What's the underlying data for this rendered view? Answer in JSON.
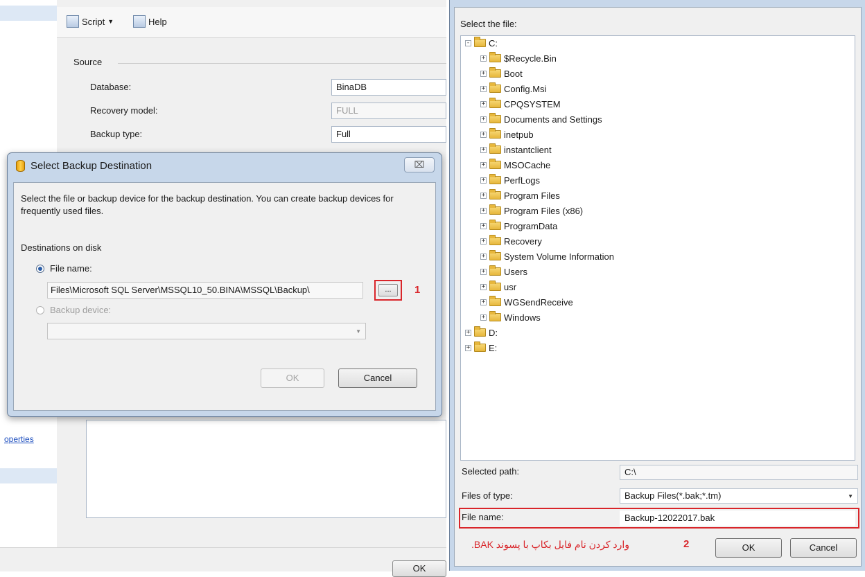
{
  "background_window": {
    "toolbar": {
      "script_label": "Script",
      "help_label": "Help"
    },
    "source_legend": "Source",
    "fields": [
      {
        "label": "Database:",
        "value": "BinaDB"
      },
      {
        "label": "Recovery model:",
        "value": "FULL"
      },
      {
        "label": "Backup type:",
        "value": "Full"
      }
    ],
    "properties_link": "operties",
    "ok_label": "OK"
  },
  "backup_destination_dialog": {
    "title": "Select Backup Destination",
    "close_glyph": "⌧",
    "description": "Select the file or backup device for the backup destination. You can create backup devices for frequently used files.",
    "destinations_label": "Destinations on disk",
    "file_name_option": "File name:",
    "file_path": "Files\\Microsoft SQL Server\\MSSQL10_50.BINA\\MSSQL\\Backup\\",
    "browse_label": "...",
    "step_marker": "1",
    "backup_device_option": "Backup device:",
    "ok_label": "OK",
    "cancel_label": "Cancel"
  },
  "locate_file_dialog": {
    "select_file_label": "Select the file:",
    "tree": {
      "root": "C:",
      "children": [
        "$Recycle.Bin",
        "Boot",
        "Config.Msi",
        "CPQSYSTEM",
        "Documents and Settings",
        "inetpub",
        "instantclient",
        "MSOCache",
        "PerfLogs",
        "Program Files",
        "Program Files (x86)",
        "ProgramData",
        "Recovery",
        "System Volume Information",
        "Users",
        "usr",
        "WGSendReceive",
        "Windows"
      ],
      "other_drives": [
        "D:",
        "E:"
      ]
    },
    "selected_path_label": "Selected path:",
    "selected_path_value": "C:\\",
    "files_of_type_label": "Files of type:",
    "files_of_type_value": "Backup Files(*.bak;*.tm)",
    "file_name_label": "File name:",
    "file_name_value": "Backup-12022017.bak",
    "step_marker": "2",
    "note": "وارد کردن نام فایل بکاپ با پسوند BAK.",
    "ok_label": "OK",
    "cancel_label": "Cancel"
  },
  "colors": {
    "highlight_red": "#d9252a",
    "dialog_frame": "#c7d7ea",
    "link_blue": "#1e4fbf"
  }
}
